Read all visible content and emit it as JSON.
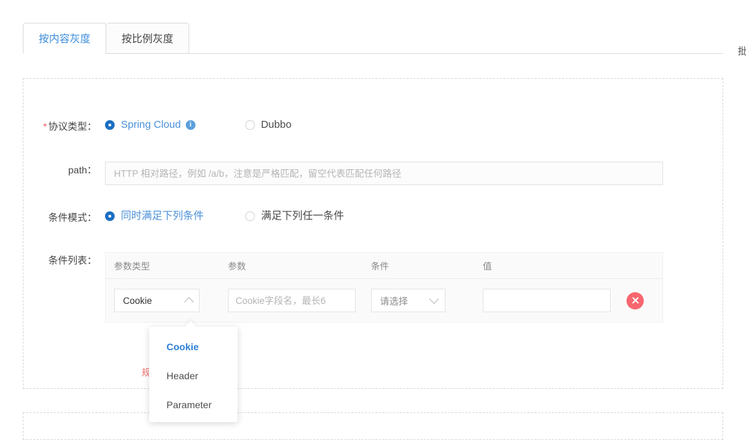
{
  "tabs": [
    {
      "label": "按内容灰度",
      "active": true
    },
    {
      "label": "按比例灰度",
      "active": false
    }
  ],
  "edge_cut_text": "批",
  "form": {
    "protocol": {
      "label": "协议类型：",
      "required": true,
      "required_marker": "*",
      "options": [
        {
          "label": "Spring Cloud",
          "selected": true,
          "has_info_icon": true,
          "info_icon": "info-circle-icon",
          "info_glyph": "i"
        },
        {
          "label": "Dubbo",
          "selected": false,
          "has_info_icon": false
        }
      ]
    },
    "path": {
      "label": "path：",
      "value": "",
      "placeholder": "HTTP 相对路径，例如 /a/b，注意是严格匹配，留空代表匹配任何路径"
    },
    "condition_mode": {
      "label": "条件模式：",
      "options": [
        {
          "label": "同时满足下列条件",
          "selected": true
        },
        {
          "label": "满足下列任一条件",
          "selected": false
        }
      ]
    },
    "condition_list": {
      "label": "条件列表：",
      "columns": [
        "参数类型",
        "参数",
        "条件",
        "值"
      ],
      "rows": [
        {
          "param_type": "Cookie",
          "param_type_chevron": "chevron-up-icon",
          "param_value": "",
          "param_placeholder": "Cookie字段名，最长6",
          "condition": "请选择",
          "condition_chevron": "chevron-down-icon",
          "value": "",
          "value_placeholder": "",
          "delete_icon": "close-circle-icon"
        }
      ]
    },
    "error_message": "规则内容填写不完整"
  },
  "dropdown": {
    "open": true,
    "items": [
      {
        "label": "Cookie",
        "selected": true
      },
      {
        "label": "Header",
        "selected": false
      },
      {
        "label": "Parameter",
        "selected": false
      }
    ]
  },
  "colors": {
    "accent_blue": "#3c8ddb",
    "selected_radio": "#1b6fc4",
    "error_red": "#f26d6d",
    "delete_red": "#f8666f",
    "required_star": "#e35b5b",
    "border_gray": "#dcdcdc",
    "table_bg": "#fafafa"
  }
}
